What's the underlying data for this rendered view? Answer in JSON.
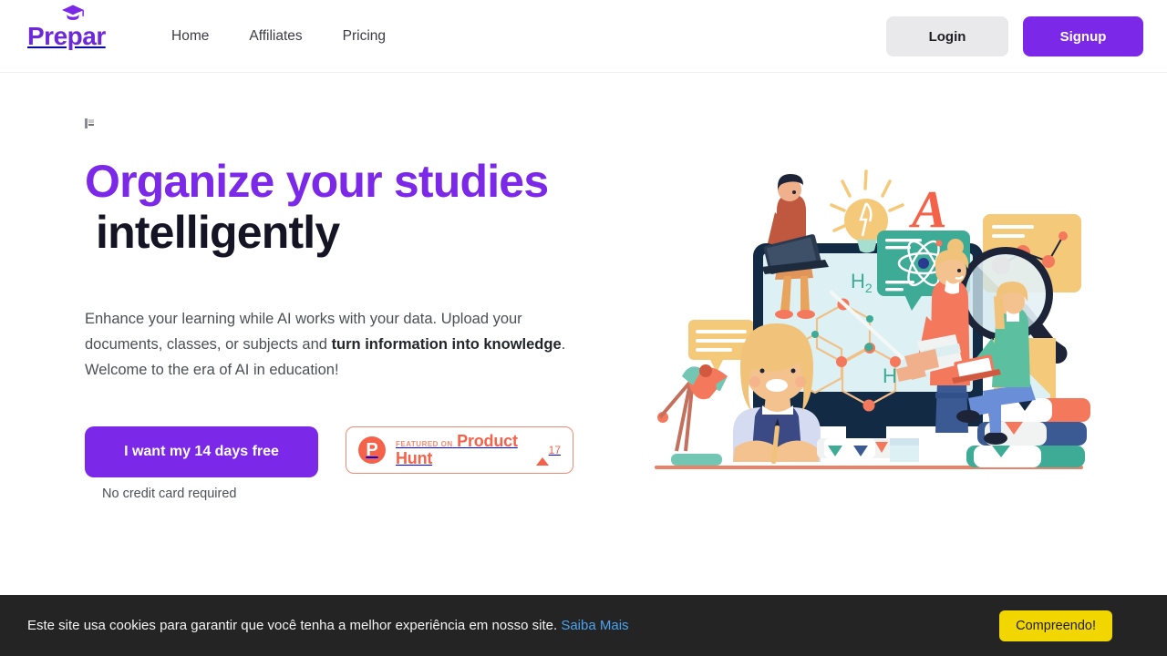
{
  "header": {
    "logo_text": "Prepar",
    "logo_icon": "graduation-cap-icon",
    "nav": [
      {
        "label": "Home"
      },
      {
        "label": "Affiliates"
      },
      {
        "label": "Pricing"
      }
    ],
    "login_label": "Login",
    "signup_label": "Signup"
  },
  "hero": {
    "title_accent": "Organize your studies",
    "title_dark": "intelligently",
    "paragraph_1": "Enhance your learning while AI works with your data. Upload your documents, classes, or subjects and ",
    "paragraph_bold": "turn information into knowledge",
    "paragraph_2": ". Welcome to the era of AI in education!",
    "cta_label": "I want my 14 days free",
    "cta_note": "No credit card required",
    "product_hunt": {
      "featured_label": "FEATURED ON",
      "name": "Product Hunt",
      "votes": "17",
      "logo_glyph": "P"
    },
    "illustration": {
      "name": "online-education-illustration",
      "labels": {
        "formula_h2": "H",
        "formula_h2_sub": "2",
        "formula_h": "H",
        "letter_a": "A"
      }
    }
  },
  "cookie_banner": {
    "message": "Este site usa cookies para garantir que você tenha a melhor experiência em nosso site.",
    "link_label": "Saiba Mais",
    "accept_label": "Compreendo!"
  },
  "colors": {
    "brand_purple": "#7c28e8",
    "logo_purple": "#6d28d9",
    "title_dark": "#141424",
    "product_hunt": "#f4624a",
    "cookie_bg": "#242424",
    "cookie_link": "#4aa3f0",
    "cookie_button": "#f1d600"
  }
}
